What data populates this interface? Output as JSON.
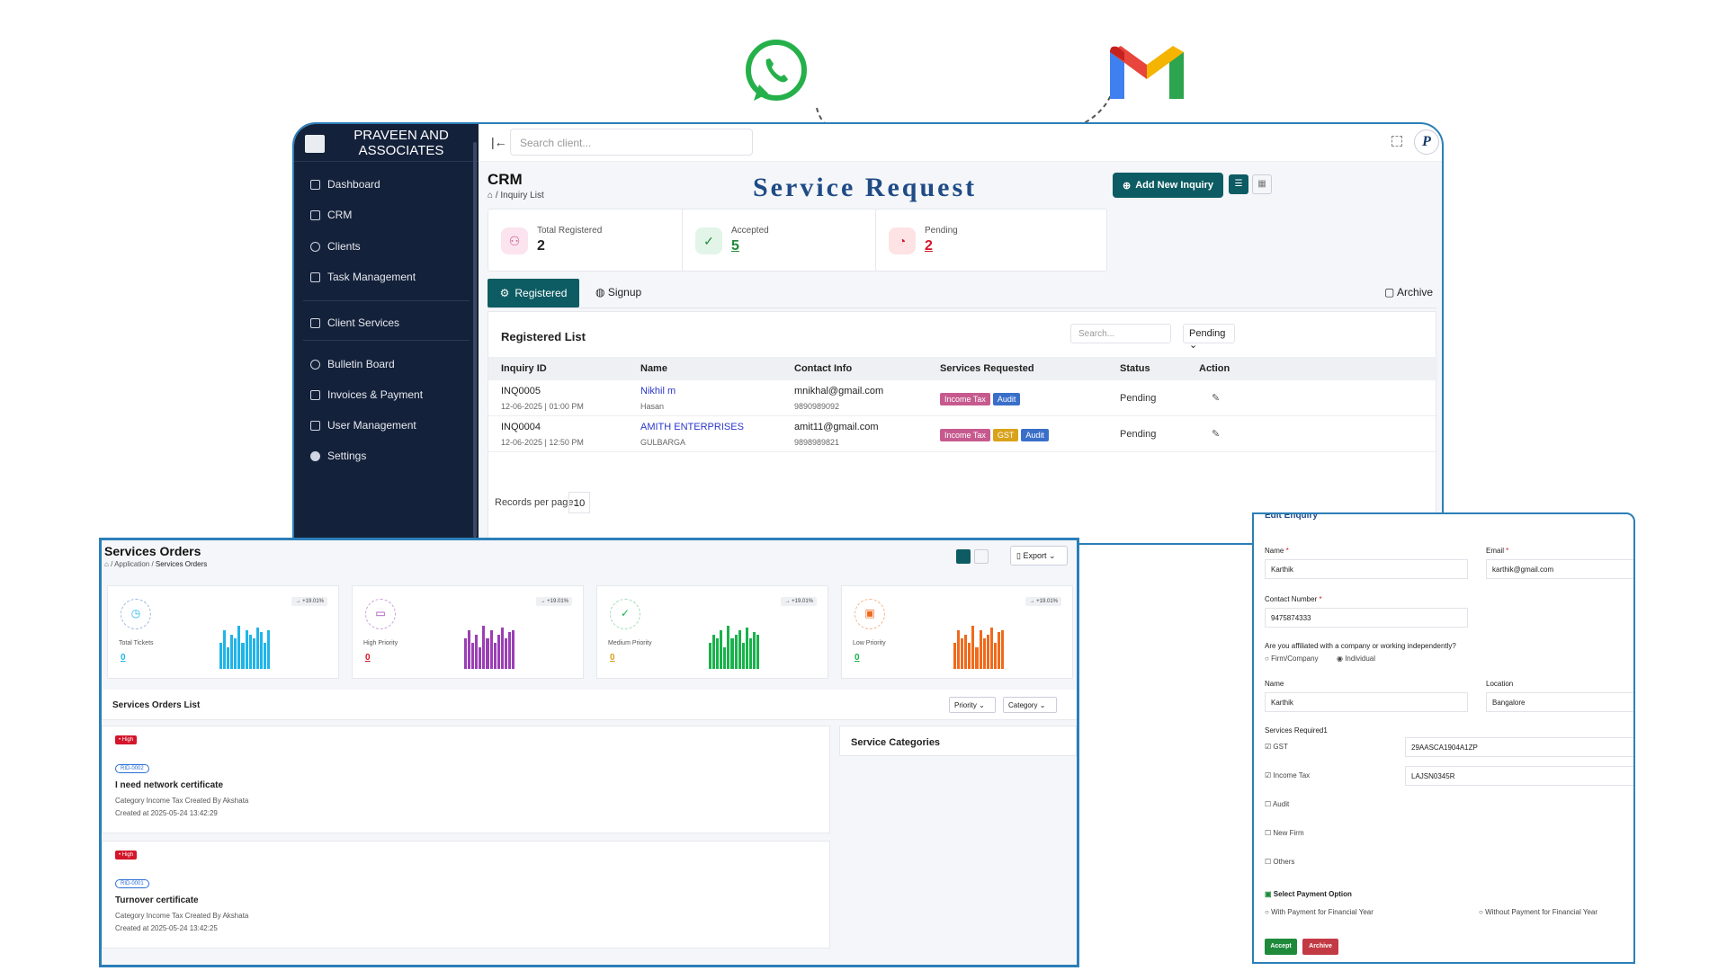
{
  "colors": {
    "teal": "#0d5c63",
    "navy": "#14213a",
    "frame": "#2b7fb8",
    "title_blue": "#1f4b86",
    "income_tax": "#c65a8e",
    "audit": "#3a6fc9",
    "gst": "#d9a21b"
  },
  "icons": {
    "whatsapp": "whatsapp-icon",
    "gmail": "gmail-icon"
  },
  "sidebar": {
    "brand": "PRAVEEN AND ASSOCIATES",
    "items": [
      {
        "label": "Dashboard",
        "icon": "home-icon"
      },
      {
        "label": "CRM",
        "icon": "grid-icon"
      },
      {
        "label": "Clients",
        "icon": "user-icon"
      },
      {
        "label": "Task Management",
        "icon": "clipboard-icon"
      },
      {
        "label": "Client Services",
        "icon": "briefcase-icon"
      },
      {
        "label": "Bulletin Board",
        "icon": "pin-icon"
      },
      {
        "label": "Invoices & Payment",
        "icon": "invoice-icon"
      },
      {
        "label": "User Management",
        "icon": "users-icon"
      },
      {
        "label": "Settings",
        "icon": "gear-icon"
      }
    ]
  },
  "topbar": {
    "search_placeholder": "Search client..."
  },
  "crm": {
    "title": "CRM",
    "breadcrumb": "Inquiry List",
    "headline": "Service Request",
    "add_button": "Add New Inquiry",
    "stats": [
      {
        "label": "Total Registered",
        "value": "2",
        "color": "#c65a8e"
      },
      {
        "label": "Accepted",
        "value": "5",
        "color": "#1e8a3a"
      },
      {
        "label": "Pending",
        "value": "2",
        "color": "#d3162a"
      }
    ],
    "tabs": [
      "Registered",
      "Signup"
    ],
    "archive": "Archive",
    "list_title": "Registered List",
    "search_placeholder": "Search...",
    "filter": "Pending",
    "columns": [
      "Inquiry ID",
      "Name",
      "Contact Info",
      "Services Requested",
      "Status",
      "Action"
    ],
    "rows": [
      {
        "id": "INQ0005",
        "date": "12-06-2025 | 01:00 PM",
        "name": "Nikhil m",
        "place": "Hasan",
        "email": "mnikhal@gmail.com",
        "phone": "9890989092",
        "services": [
          "Income Tax",
          "Audit"
        ],
        "status": "Pending"
      },
      {
        "id": "INQ0004",
        "date": "12-06-2025 | 12:50 PM",
        "name": "AMITH ENTERPRISES",
        "place": "GULBARGA",
        "email": "amit11@gmail.com",
        "phone": "9898989821",
        "services": [
          "Income Tax",
          "GST",
          "Audit"
        ],
        "status": "Pending"
      }
    ],
    "records_label": "Records per page:",
    "records_value": "10"
  },
  "services_orders": {
    "title": "Services Orders",
    "breadcrumb_1": "Application",
    "breadcrumb_2": "Services Orders",
    "export": "Export",
    "cards": [
      {
        "label": "Total Tickets",
        "value": "0",
        "pct": "→ +19.01%",
        "color": "#1fb5e8",
        "bars": [
          0.6,
          0.9,
          0.5,
          0.8,
          0.7,
          1.0,
          0.6,
          0.9,
          0.8,
          0.7,
          0.95,
          0.85,
          0.6,
          0.9
        ]
      },
      {
        "label": "High Priority",
        "value": "0",
        "pct": "→ +19.01%",
        "color": "#9b3fb5",
        "bars": [
          0.7,
          0.9,
          0.6,
          0.8,
          0.5,
          1.0,
          0.7,
          0.9,
          0.6,
          0.8,
          0.95,
          0.7,
          0.85,
          0.9
        ]
      },
      {
        "label": "Medium Priority",
        "value": "0",
        "pct": "→ +19.01%",
        "color": "#19b24b",
        "bars": [
          0.6,
          0.8,
          0.7,
          0.9,
          0.5,
          1.0,
          0.7,
          0.8,
          0.9,
          0.6,
          0.95,
          0.7,
          0.85,
          0.8
        ]
      },
      {
        "label": "Low Priority",
        "value": "0",
        "pct": "→ +19.01%",
        "color": "#ef6a1c",
        "bars": [
          0.6,
          0.9,
          0.7,
          0.8,
          0.6,
          1.0,
          0.5,
          0.9,
          0.7,
          0.8,
          0.95,
          0.6,
          0.85,
          0.9
        ]
      }
    ],
    "list_title": "Services Orders List",
    "priority": "Priority",
    "category": "Category",
    "categories_title": "Service Categories",
    "orders": [
      {
        "badge": "• High",
        "rid": "RID-0002",
        "title": "I need network certificate",
        "meta": "Category Income Tax   Created By Akshata",
        "created": "Created at 2025-05-24 13:42:29"
      },
      {
        "badge": "• High",
        "rid": "RID-0001",
        "title": "Turnover certificate",
        "meta": "Category Income Tax   Created By Akshata",
        "created": "Created at 2025-05-24 13:42:25"
      }
    ]
  },
  "form": {
    "heading": "Edit Enquiry",
    "name_label": "Name",
    "name_value": "Karthik",
    "email_label": "Email",
    "email_value": "karthik@gmail.com",
    "contact_label": "Contact Number",
    "contact_value": "9475874333",
    "affiliation_q": "Are you affiliated with a company or working independently?",
    "opt_firm": "Firm/Company",
    "opt_individual": "Individual",
    "name2_label": "Name",
    "name2_value": "Karthik",
    "location_label": "Location",
    "location_value": "Bangalore",
    "services_label": "Services Required1",
    "gst": "GST",
    "gst_value": "29AASCA1904A1ZP",
    "income_tax": "Income Tax",
    "income_tax_value": "LAJSN0345R",
    "audit": "Audit",
    "new_firm": "New Firm",
    "others": "Others",
    "payment_label": "Select Payment Option",
    "pay_with": "With Payment for Financial Year",
    "pay_without": "Without Payment for Financial Year",
    "accept": "Accept",
    "archive": "Archive"
  }
}
